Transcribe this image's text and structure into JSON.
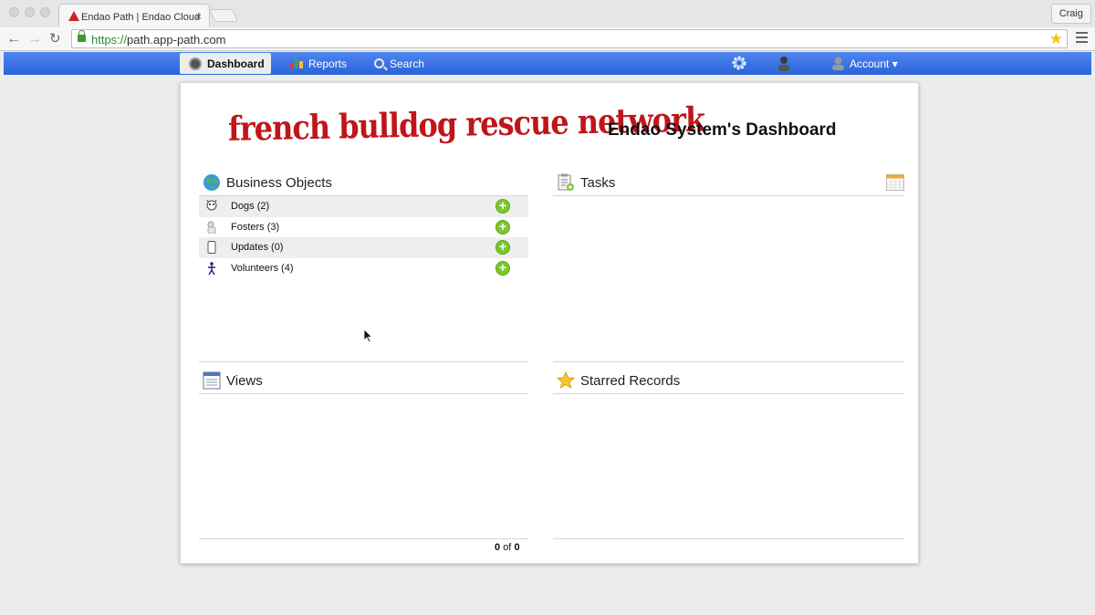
{
  "browser": {
    "tab_title": "Endao Path | Endao Cloud",
    "tab_close": "×",
    "user_label": "Craig",
    "url_protocol": "https://",
    "url_host": "path.app-path.com"
  },
  "nav": {
    "items": [
      {
        "label": "Dashboard",
        "icon": "dashboard-icon",
        "active": true
      },
      {
        "label": "Reports",
        "icon": "bar-chart-icon"
      },
      {
        "label": "Search",
        "icon": "search-icon"
      }
    ],
    "right_icons": [
      "settings-gear-icon",
      "admin-user-icon"
    ],
    "account_label": "Account ▾"
  },
  "dashboard": {
    "logo_text": "french bulldog rescue network",
    "title": "Endao System's Dashboard",
    "business_objects": {
      "title": "Business Objects",
      "icon": "globe-icon",
      "items": [
        {
          "label": "Dogs (2)",
          "icon": "dog-icon"
        },
        {
          "label": "Fosters (3)",
          "icon": "foster-icon"
        },
        {
          "label": "Updates (0)",
          "icon": "mobile-phone-icon"
        },
        {
          "label": "Volunteers (4)",
          "icon": "person-icon"
        }
      ],
      "add_symbol": "+"
    },
    "tasks": {
      "title": "Tasks",
      "icon": "clipboard-add-icon",
      "action_icon": "calendar-icon"
    },
    "views": {
      "title": "Views",
      "icon": "window-list-icon",
      "pager": {
        "current": "0",
        "of": "of",
        "total": "0"
      }
    },
    "starred": {
      "title": "Starred Records",
      "icon": "star-icon"
    }
  },
  "colors": {
    "nav_blue": "#2f6ae0",
    "logo_red": "#c0151a",
    "add_green": "#7bc82b"
  }
}
